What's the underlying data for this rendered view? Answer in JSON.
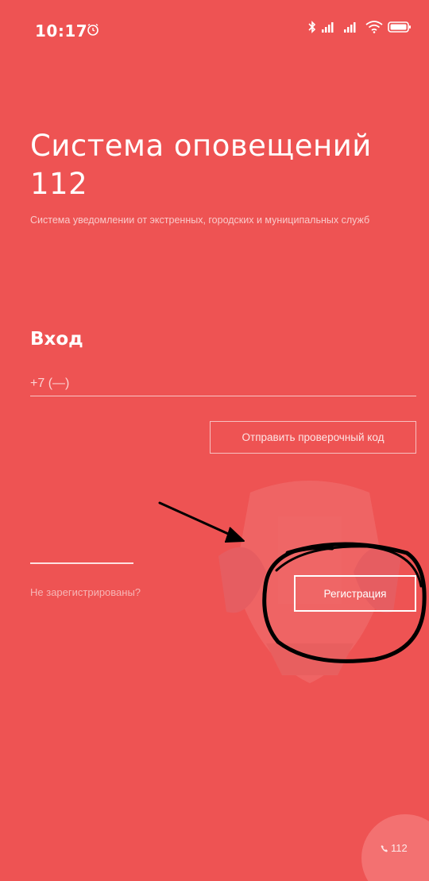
{
  "status_bar": {
    "time": "10:17",
    "icons": [
      "alarm-icon",
      "bluetooth-icon",
      "signal-icon",
      "signal-icon",
      "wifi-icon",
      "battery-icon"
    ]
  },
  "header": {
    "title": "Система оповещений 112",
    "subtitle": "Система уведомлении от экстренных, городских и муниципальных служб"
  },
  "login": {
    "heading": "Вход",
    "phone_placeholder": "+7 (—)",
    "send_code_label": "Отправить проверочный код"
  },
  "registration": {
    "prompt": "Не зарегистрированы?",
    "button_label": "Регистрация"
  },
  "fab": {
    "label": "112",
    "icon": "phone-icon"
  },
  "colors": {
    "background": "#ee5353",
    "text": "#ffffff",
    "annotation": "#000000"
  }
}
